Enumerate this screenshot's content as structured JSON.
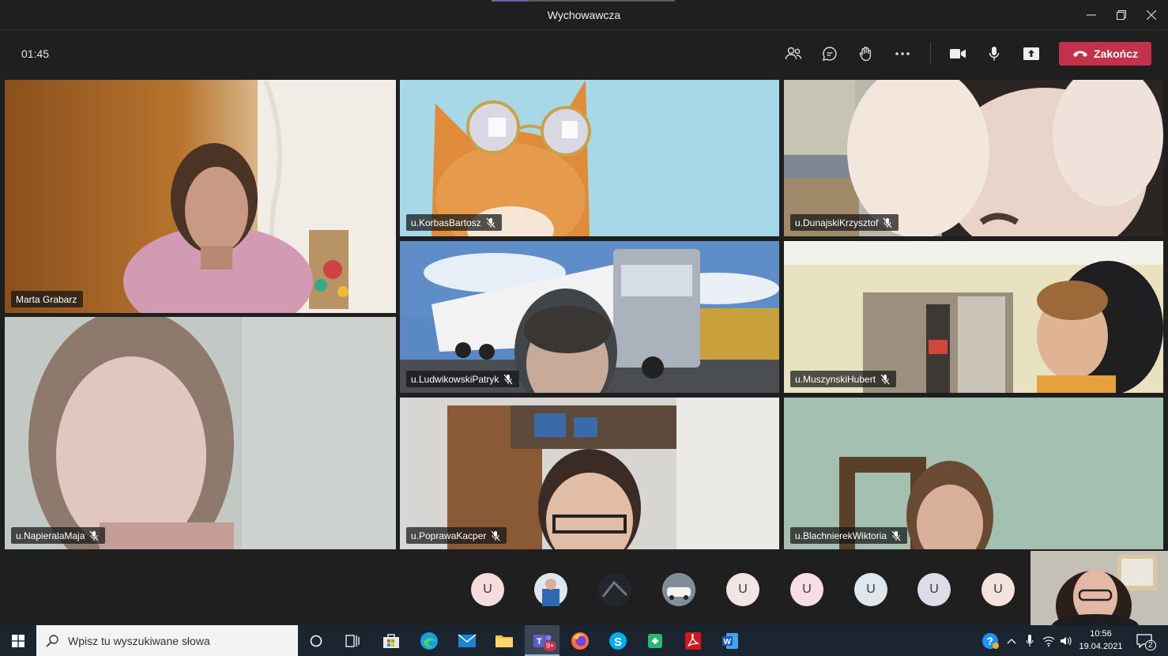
{
  "window": {
    "title": "Wychowawcza",
    "buttons": [
      "minimize",
      "restore",
      "close"
    ]
  },
  "meeting": {
    "timer": "01:45",
    "end_button_label": "Zakończ",
    "toolbar_icons": [
      "participants-icon",
      "chat-icon",
      "raise-hand-icon",
      "more-options-icon",
      "camera-icon",
      "microphone-icon",
      "share-screen-icon"
    ]
  },
  "participants": [
    {
      "name": "Marta Grabarz",
      "muted": false
    },
    {
      "name": "u.KorbasBartosz",
      "muted": true
    },
    {
      "name": "u.DunajskiKrzysztof",
      "muted": true
    },
    {
      "name": "u.LudwikowskiPatryk",
      "muted": true
    },
    {
      "name": "u.MuszynskiHubert",
      "muted": true
    },
    {
      "name": "u.NapieralaMaja",
      "muted": true
    },
    {
      "name": "u.PoprawaKacper",
      "muted": true
    },
    {
      "name": "u.BlachnierekWiktoria",
      "muted": true
    }
  ],
  "overflow_avatars": [
    {
      "initial": "U",
      "color": "#f6dcdc"
    },
    {
      "initial": "",
      "color": "#4f7fb3"
    },
    {
      "initial": "",
      "color": "#2a2e33"
    },
    {
      "initial": "",
      "color": "#8a9aa8"
    },
    {
      "initial": "U",
      "color": "#f2e6e4"
    },
    {
      "initial": "U",
      "color": "#f7dde6"
    },
    {
      "initial": "U",
      "color": "#dfe7ec"
    },
    {
      "initial": "U",
      "color": "#dfdcea"
    },
    {
      "initial": "U",
      "color": "#f6e2dc"
    }
  ],
  "taskbar": {
    "search_placeholder": "Wpisz tu wyszukiwane słowa",
    "teams_badge": "9+",
    "time": "10:56",
    "date": "19.04.2021",
    "notification_count": "2"
  }
}
